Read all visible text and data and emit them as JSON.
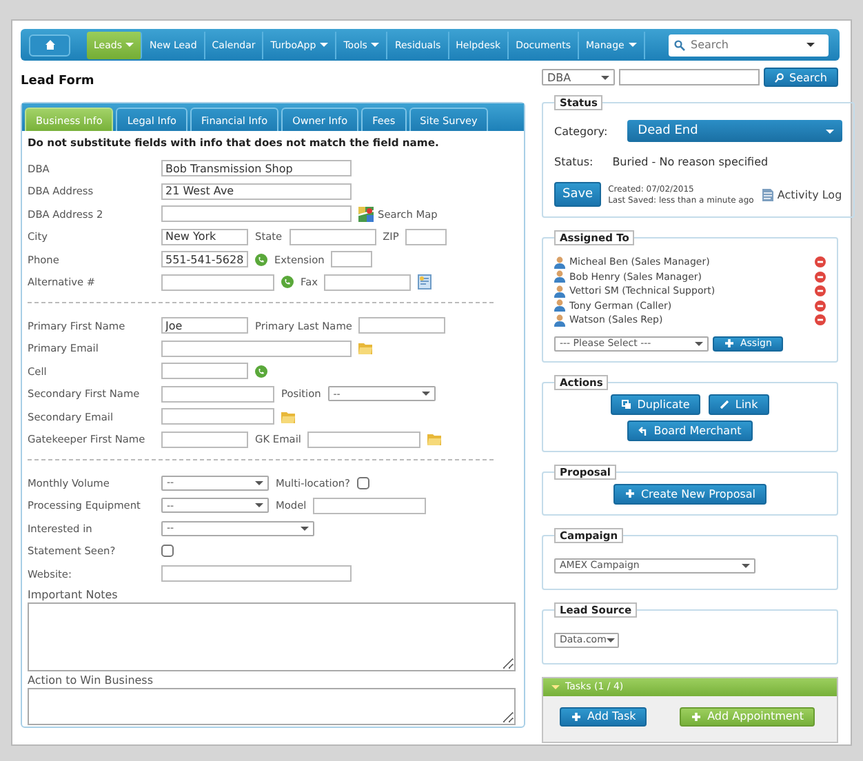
{
  "nav": {
    "items": [
      {
        "label": "Leads",
        "selected": true,
        "dropdown": true
      },
      {
        "label": "New Lead",
        "selected": false,
        "dropdown": false
      },
      {
        "label": "Calendar",
        "selected": false,
        "dropdown": false
      },
      {
        "label": "TurboApp",
        "selected": false,
        "dropdown": true
      },
      {
        "label": "Tools",
        "selected": false,
        "dropdown": true
      },
      {
        "label": "Residuals",
        "selected": false,
        "dropdown": false
      },
      {
        "label": "Helpdesk",
        "selected": false,
        "dropdown": false
      },
      {
        "label": "Documents",
        "selected": false,
        "dropdown": false
      },
      {
        "label": "Manage",
        "selected": false,
        "dropdown": true
      }
    ],
    "search": {
      "placeholder": "Search"
    }
  },
  "page_title": "Lead Form",
  "tabs": [
    {
      "label": "Business Info",
      "selected": true
    },
    {
      "label": "Legal Info",
      "selected": false
    },
    {
      "label": "Financial Info",
      "selected": false
    },
    {
      "label": "Owner Info",
      "selected": false
    },
    {
      "label": "Fees",
      "selected": false
    },
    {
      "label": "Site Survey",
      "selected": false
    }
  ],
  "notice": "Do not substitute fields with info that does not match the field name.",
  "sections": [
    [
      [
        {
          "kind": "label",
          "text": "DBA"
        },
        {
          "kind": "text-long",
          "value": "Bob Transmission Shop"
        }
      ],
      [
        {
          "kind": "label",
          "text": "DBA Address"
        },
        {
          "kind": "text-long",
          "value": "21 West Ave"
        }
      ],
      [
        {
          "kind": "label",
          "text": "DBA Address 2"
        },
        {
          "kind": "text-long"
        },
        {
          "kind": "map",
          "text": "Search Map"
        }
      ],
      [
        {
          "kind": "label",
          "text": "City"
        },
        {
          "kind": "text-short",
          "value": "New York"
        },
        {
          "kind": "label",
          "text": "State"
        },
        {
          "kind": "text-short"
        },
        {
          "kind": "label",
          "text": "ZIP"
        },
        {
          "kind": "text-tiny"
        }
      ],
      [
        {
          "kind": "label",
          "text": "Phone"
        },
        {
          "kind": "text-short",
          "value": "551-541-5628"
        },
        {
          "kind": "call"
        },
        {
          "kind": "label",
          "text": "Extension"
        },
        {
          "kind": "text-tiny"
        }
      ],
      [
        {
          "kind": "label",
          "text": "Alternative #"
        },
        {
          "kind": "text-medium"
        },
        {
          "kind": "call"
        },
        {
          "kind": "label",
          "text": "Fax"
        },
        {
          "kind": "text-short"
        },
        {
          "kind": "card"
        }
      ]
    ],
    [
      [
        {
          "kind": "label",
          "text": "Primary First Name"
        },
        {
          "kind": "text-short",
          "value": "Joe"
        },
        {
          "kind": "label",
          "text": "Primary Last Name"
        },
        {
          "kind": "text-short"
        }
      ],
      [
        {
          "kind": "label",
          "text": "Primary Email"
        },
        {
          "kind": "text-long"
        },
        {
          "kind": "mail"
        }
      ],
      [
        {
          "kind": "label",
          "text": "Cell"
        },
        {
          "kind": "text-short"
        },
        {
          "kind": "call"
        }
      ],
      [
        {
          "kind": "label",
          "text": "Secondary First Name"
        },
        {
          "kind": "text-medium"
        },
        {
          "kind": "label",
          "text": "Position"
        },
        {
          "kind": "select-short",
          "value": "--"
        }
      ],
      [
        {
          "kind": "label",
          "text": "Secondary Email"
        },
        {
          "kind": "text-medium"
        },
        {
          "kind": "mail"
        }
      ],
      [
        {
          "kind": "label",
          "text": "Gatekeeper First Name"
        },
        {
          "kind": "text-short"
        },
        {
          "kind": "label",
          "text": "GK Email"
        },
        {
          "kind": "text-medium"
        },
        {
          "kind": "mail"
        }
      ]
    ],
    [
      [
        {
          "kind": "label",
          "text": "Monthly Volume"
        },
        {
          "kind": "select-short",
          "value": "--"
        },
        {
          "kind": "label",
          "text": "Multi-location?"
        },
        {
          "kind": "checkbox",
          "checked": false
        }
      ],
      [
        {
          "kind": "label",
          "text": "Processing Equipment"
        },
        {
          "kind": "select-short",
          "value": "--"
        },
        {
          "kind": "label",
          "text": "Model"
        },
        {
          "kind": "text-medium"
        }
      ],
      [
        {
          "kind": "label",
          "text": "Interested in"
        },
        {
          "kind": "select-long",
          "value": "--"
        }
      ],
      [
        {
          "kind": "label",
          "text": "Statement Seen?"
        },
        {
          "kind": "checkbox",
          "checked": false
        }
      ],
      [
        {
          "kind": "label",
          "text": "Website:"
        },
        {
          "kind": "text-long"
        }
      ]
    ]
  ],
  "notes": [
    {
      "label": "Important Notes"
    },
    {
      "label": "Action to Win Business"
    }
  ],
  "lookup": {
    "field": "DBA",
    "button": "Search"
  },
  "status": {
    "title": "Status",
    "category_label": "Category:",
    "category": "Dead End",
    "status_label": "Status:",
    "status": "Buried - No reason specified",
    "save": "Save",
    "created": "Created: 07/02/2015",
    "last_saved": "Last Saved: less than a minute ago",
    "activity_log": "Activity Log"
  },
  "assigned": {
    "title": "Assigned To",
    "people": [
      {
        "name": "Micheal Ben (Sales Manager)"
      },
      {
        "name": "Bob Henry (Sales Manager)"
      },
      {
        "name": "Vettori SM (Technical Support)"
      },
      {
        "name": "Tony German (Caller)"
      },
      {
        "name": "Watson (Sales Rep)"
      }
    ],
    "select": "--- Please Select ---",
    "button": "Assign"
  },
  "actions": {
    "title": "Actions",
    "buttons": [
      {
        "label": "Duplicate",
        "kind": "duplicate"
      },
      {
        "label": "Link",
        "kind": "link"
      },
      {
        "label": "Board Merchant",
        "kind": "board"
      }
    ]
  },
  "proposal": {
    "title": "Proposal",
    "button": "Create New Proposal"
  },
  "campaign": {
    "title": "Campaign",
    "value": "AMEX Campaign"
  },
  "lead_source": {
    "title": "Lead Source",
    "value": "Data.com"
  },
  "tasks": {
    "title": "Tasks (1 / 4)",
    "expanded": true,
    "buttons": [
      {
        "label": "Add Task",
        "kind": "task"
      },
      {
        "label": "Add Appointment",
        "kind": "appointment"
      }
    ]
  }
}
